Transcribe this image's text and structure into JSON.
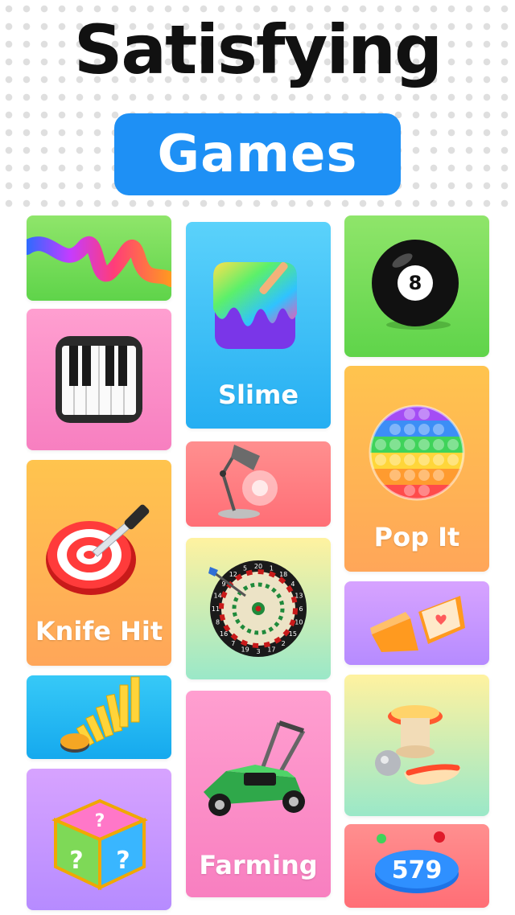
{
  "header": {
    "title": "Satisfying",
    "subtitle": "Games"
  },
  "colors": {
    "accent": "#1e90f5",
    "title_text": "#111111"
  },
  "tiles": [
    {
      "id": "ribbon",
      "icon": "ribbon-icon",
      "label": ""
    },
    {
      "id": "piano",
      "icon": "piano-icon",
      "label": ""
    },
    {
      "id": "knife-hit",
      "icon": "knife-target-icon",
      "label": "Knife Hit"
    },
    {
      "id": "domino",
      "icon": "domino-icon",
      "label": ""
    },
    {
      "id": "mystery-box",
      "icon": "mystery-cube-icon",
      "label": ""
    },
    {
      "id": "slime",
      "icon": "slime-icon",
      "label": "Slime"
    },
    {
      "id": "lamp",
      "icon": "desk-lamp-icon",
      "label": ""
    },
    {
      "id": "darts",
      "icon": "dartboard-icon",
      "label": ""
    },
    {
      "id": "farming",
      "icon": "lawn-mower-icon",
      "label": "Farming"
    },
    {
      "id": "eight-ball",
      "icon": "eight-ball-icon",
      "label": ""
    },
    {
      "id": "pop-it",
      "icon": "pop-it-icon",
      "label": "Pop It"
    },
    {
      "id": "cake",
      "icon": "cake-slice-icon",
      "label": ""
    },
    {
      "id": "pinball",
      "icon": "pinball-icon",
      "label": ""
    },
    {
      "id": "number-ball",
      "icon": "number-ball-icon",
      "label": ""
    }
  ],
  "icon_text": {
    "eight_ball": "8",
    "number_ball": "579",
    "dartboard": [
      "20",
      "1",
      "18",
      "4",
      "13",
      "6",
      "10",
      "15",
      "2",
      "17",
      "3",
      "19",
      "7",
      "16",
      "8",
      "11",
      "14",
      "9",
      "12",
      "5"
    ]
  }
}
